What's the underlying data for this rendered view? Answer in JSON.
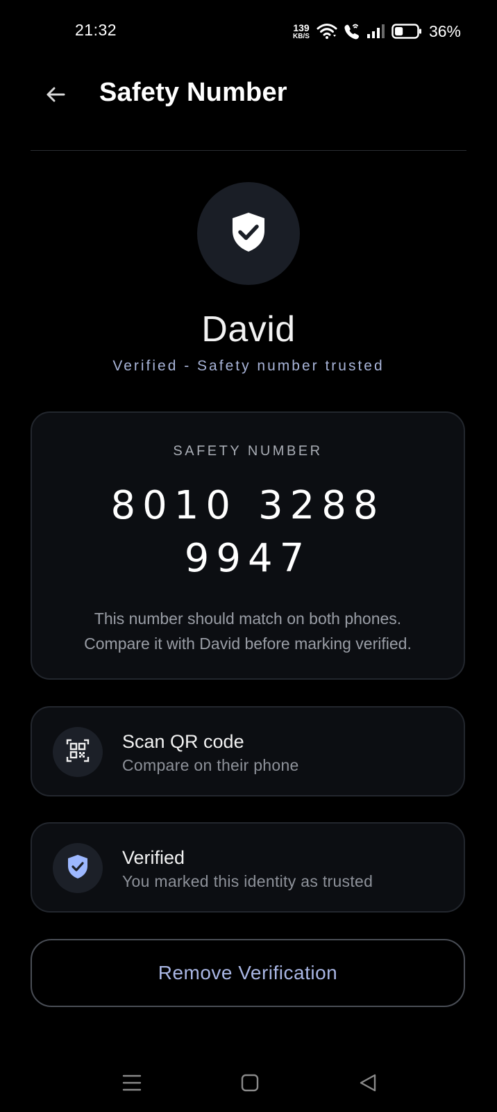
{
  "status_bar": {
    "time": "21:32",
    "net_speed_value": "139",
    "net_speed_unit": "KB/S",
    "battery_percent": "36%",
    "battery_level": 0.36
  },
  "app_bar": {
    "title": "Safety Number",
    "back_icon": "arrow-left-icon"
  },
  "contact": {
    "name": "David",
    "status": "Verified - Safety number trusted",
    "avatar_icon": "shield-check-icon"
  },
  "safety_card": {
    "label": "SAFETY NUMBER",
    "groups": [
      "8010",
      "3288",
      "9947"
    ],
    "description_line1": "This number should match on both phones.",
    "description_line2": "Compare it with David before marking verified."
  },
  "actions": [
    {
      "icon": "qr-code-icon",
      "title": "Scan QR code",
      "subtitle": "Compare on their phone"
    },
    {
      "icon": "shield-check-icon",
      "title": "Verified",
      "subtitle": "You marked this identity as trusted"
    }
  ],
  "remove_button": {
    "label": "Remove Verification"
  },
  "nav_bar": {
    "items": [
      "menu-icon",
      "home-icon",
      "back-triangle-icon"
    ]
  },
  "colors": {
    "background": "#000000",
    "card_background": "#0c0e12",
    "accent": "#a9b6e4",
    "verified_icon": "#9db8ff"
  }
}
